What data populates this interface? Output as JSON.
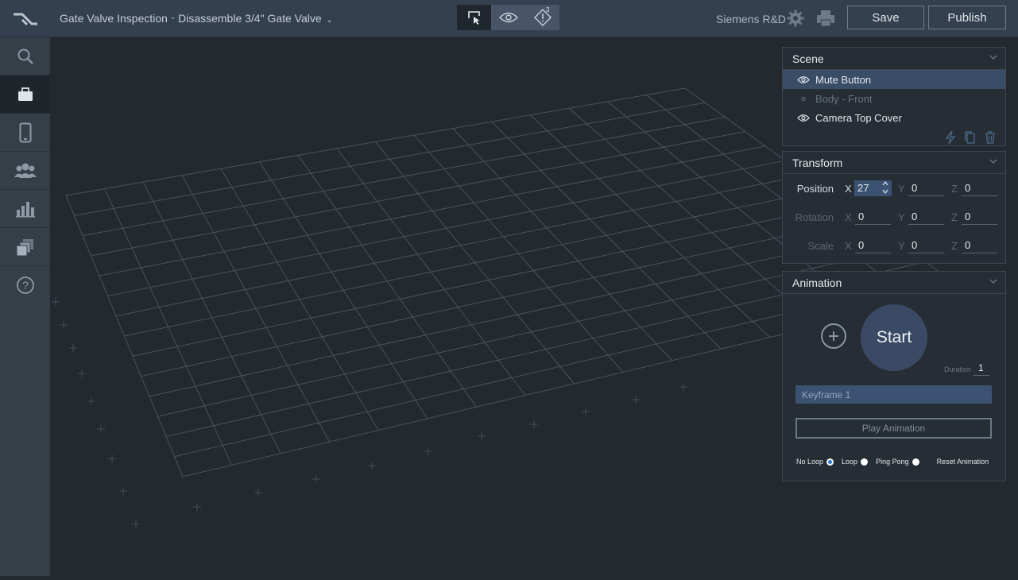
{
  "header": {
    "breadcrumb_project": "Gate Valve Inspection",
    "breadcrumb_separator": "•",
    "breadcrumb_document": "Disassemble 3/4\" Gate Valve",
    "warning_count": "3",
    "org_name": "Siemens R&D",
    "save_label": "Save",
    "publish_label": "Publish",
    "modes": [
      "select-mode-icon",
      "preview-eye-icon",
      "warning-diamond-icon"
    ]
  },
  "sidebar": {
    "items": [
      {
        "icon": "search-icon"
      },
      {
        "icon": "briefcase-icon",
        "active": true
      },
      {
        "icon": "mobile-device-icon"
      },
      {
        "icon": "users-group-icon"
      },
      {
        "icon": "bar-chart-icon"
      },
      {
        "icon": "stacked-pages-icon"
      },
      {
        "icon": "help-circle-icon"
      }
    ]
  },
  "scene": {
    "title": "Scene",
    "items": [
      {
        "label": "Mute Button",
        "icon": "eye-icon",
        "selected": true
      },
      {
        "label": "Body - Front",
        "icon": "dot-icon",
        "dim": true
      },
      {
        "label": "Camera Top Cover",
        "icon": "eye-icon"
      }
    ],
    "tools": [
      "lightning-icon",
      "duplicate-icon",
      "trash-icon"
    ]
  },
  "transform": {
    "title": "Transform",
    "position": {
      "label": "Position",
      "x": "27",
      "y": "0",
      "z": "0"
    },
    "rotation": {
      "label": "Rotation",
      "x": "0",
      "y": "0",
      "z": "0"
    },
    "scale": {
      "label": "Scale",
      "x": "0",
      "y": "0",
      "z": "0"
    },
    "axis_x": "X",
    "axis_y": "Y",
    "axis_z": "Z"
  },
  "animation": {
    "title": "Animation",
    "start_label": "Start",
    "duration_label": "Duration",
    "duration_value": "1",
    "keyframe_label": "Keyframe 1",
    "play_label": "Play Animation",
    "no_loop_label": "No Loop",
    "loop_label": "Loop",
    "ping_pong_label": "Ping Pong",
    "reset_label": "Reset Animation",
    "selected_mode": "No Loop"
  },
  "colors": {
    "topbar": "#34404f",
    "sidebar": "#363e48",
    "viewport": "#23292f",
    "selection": "#3a4d66",
    "accent": "#2f77d6"
  }
}
